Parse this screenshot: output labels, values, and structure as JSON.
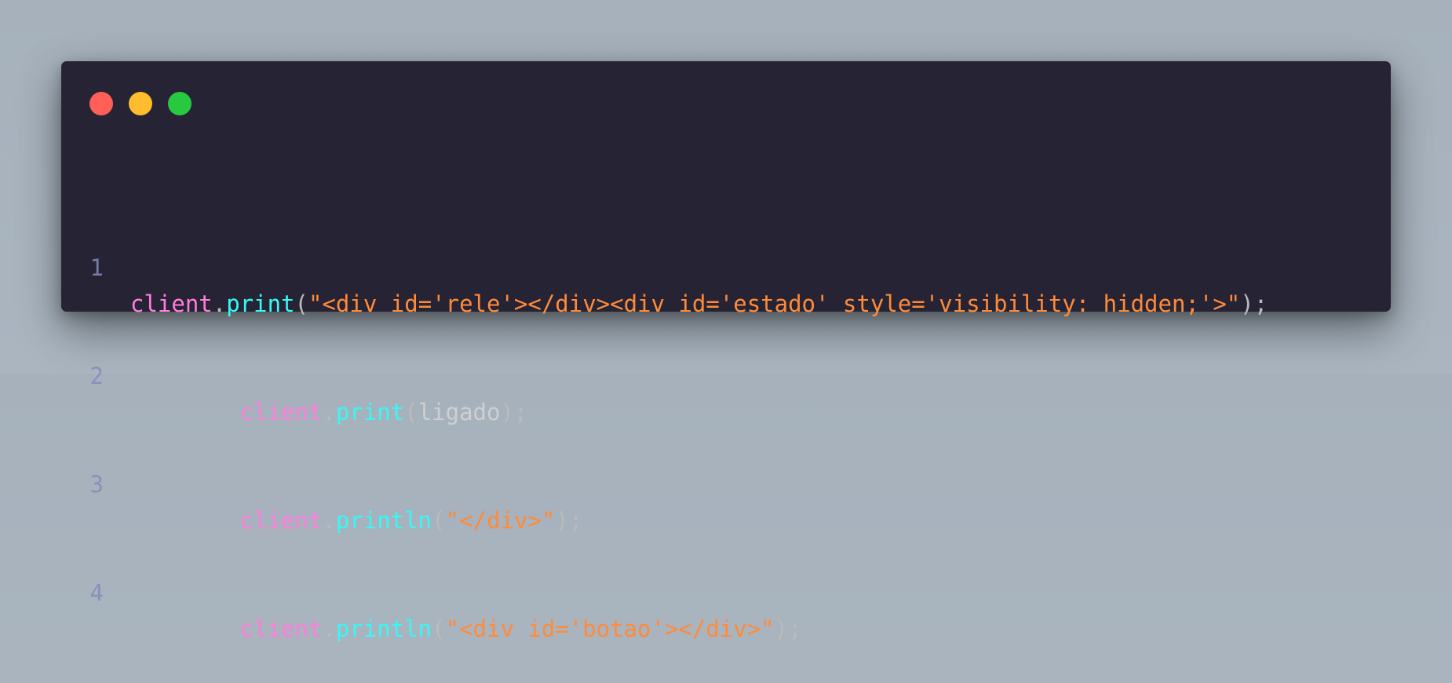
{
  "window": {
    "controls": {
      "close_color": "#fe5f57",
      "minimize_color": "#febc2e",
      "maximize_color": "#28c840"
    }
  },
  "code": {
    "lines": [
      {
        "number": "1",
        "indent": "",
        "object": "client",
        "dot": ".",
        "method": "print",
        "open": "(",
        "argument": "\"<div id='rele'></div><div id='estado' style='visibility: hidden;'>\"",
        "argument_kind": "string",
        "close": ");"
      },
      {
        "number": "2",
        "indent": "        ",
        "object": "client",
        "dot": ".",
        "method": "print",
        "open": "(",
        "argument": "ligado",
        "argument_kind": "identifier",
        "close": ");"
      },
      {
        "number": "3",
        "indent": "        ",
        "object": "client",
        "dot": ".",
        "method": "println",
        "open": "(",
        "argument": "\"</div>\"",
        "argument_kind": "string",
        "close": ");"
      },
      {
        "number": "4",
        "indent": "        ",
        "object": "client",
        "dot": ".",
        "method": "println",
        "open": "(",
        "argument": "\"<div id='botao'></div>\"",
        "argument_kind": "string",
        "close": ");"
      }
    ]
  }
}
